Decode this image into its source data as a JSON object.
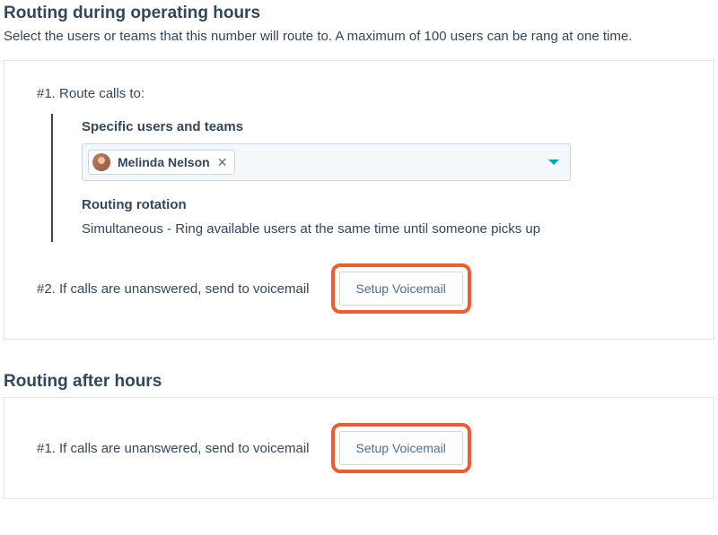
{
  "operating": {
    "title": "Routing during operating hours",
    "description": "Select the users or teams that this number will route to. A maximum of 100 users can be rang at one time.",
    "step1_label": "#1. Route calls to:",
    "specific_users_heading": "Specific users and teams",
    "selected_user": "Melinda Nelson",
    "rotation_heading": "Routing rotation",
    "rotation_text": "Simultaneous - Ring available users at the same time until someone picks up",
    "step2_label": "#2. If calls are unanswered, send to voicemail",
    "voicemail_btn": "Setup Voicemail"
  },
  "after_hours": {
    "title": "Routing after hours",
    "step1_label": "#1. If calls are unanswered, send to voicemail",
    "voicemail_btn": "Setup Voicemail"
  }
}
